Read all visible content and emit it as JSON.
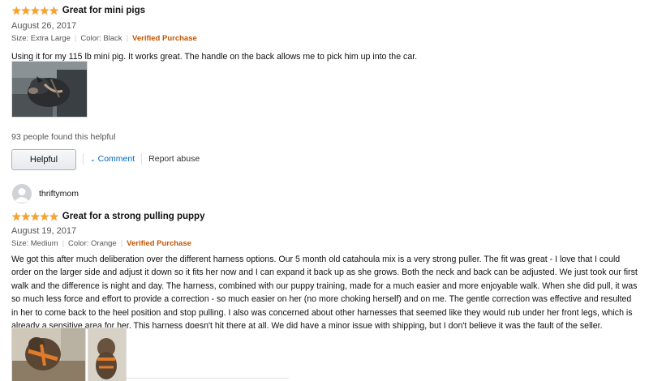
{
  "review1": {
    "stars": "★★★★★",
    "title": "Great for mini pigs",
    "date": "August 26, 2017",
    "size": "Size: Extra Large",
    "color": "Color: Black",
    "verified": "Verified Purchase",
    "text": "Using it for my 115 lb mini pig. It works great. The handle on the back allows me to pick him up into the car.",
    "helpful_count": "93 people found this helpful",
    "helpful_label": "Helpful",
    "comment_label": "Comment",
    "report_label": "Report abuse"
  },
  "review2": {
    "profile_name": "thriftymom",
    "stars": "★★★★★",
    "title": "Great for a strong pulling puppy",
    "date": "August 19, 2017",
    "size": "Size: Medium",
    "color": "Color: Orange",
    "verified": "Verified Purchase",
    "text": "We got this after much deliberation over the different harness options. Our 5 month old catahoula mix is a very strong puller. The fit was great - I love that I could order on the larger side and adjust it down so it fits her now and I can expand it back up as she grows. Both the neck and back can be adjusted. We just took our first walk and the difference is night and day. The harness, combined with our puppy training, made for a much easier and more enjoyable walk. When she did pull, it was so much less force and effort to provide a correction - so much easier on her (no more choking herself) and on me. The gentle correction was effective and resulted in her to come back to the heel position and stop pulling. I also was concerned about other harnesses that seemed like they would rub under her front legs, which is already a sensitive area for her. This harness doesn't hit there at all. We did have a minor issue with shipping, but I don't believe it was the fault of the seller."
  },
  "colors": {
    "star": "#f7a32b",
    "verified": "#c45500",
    "link": "#0066c0"
  }
}
